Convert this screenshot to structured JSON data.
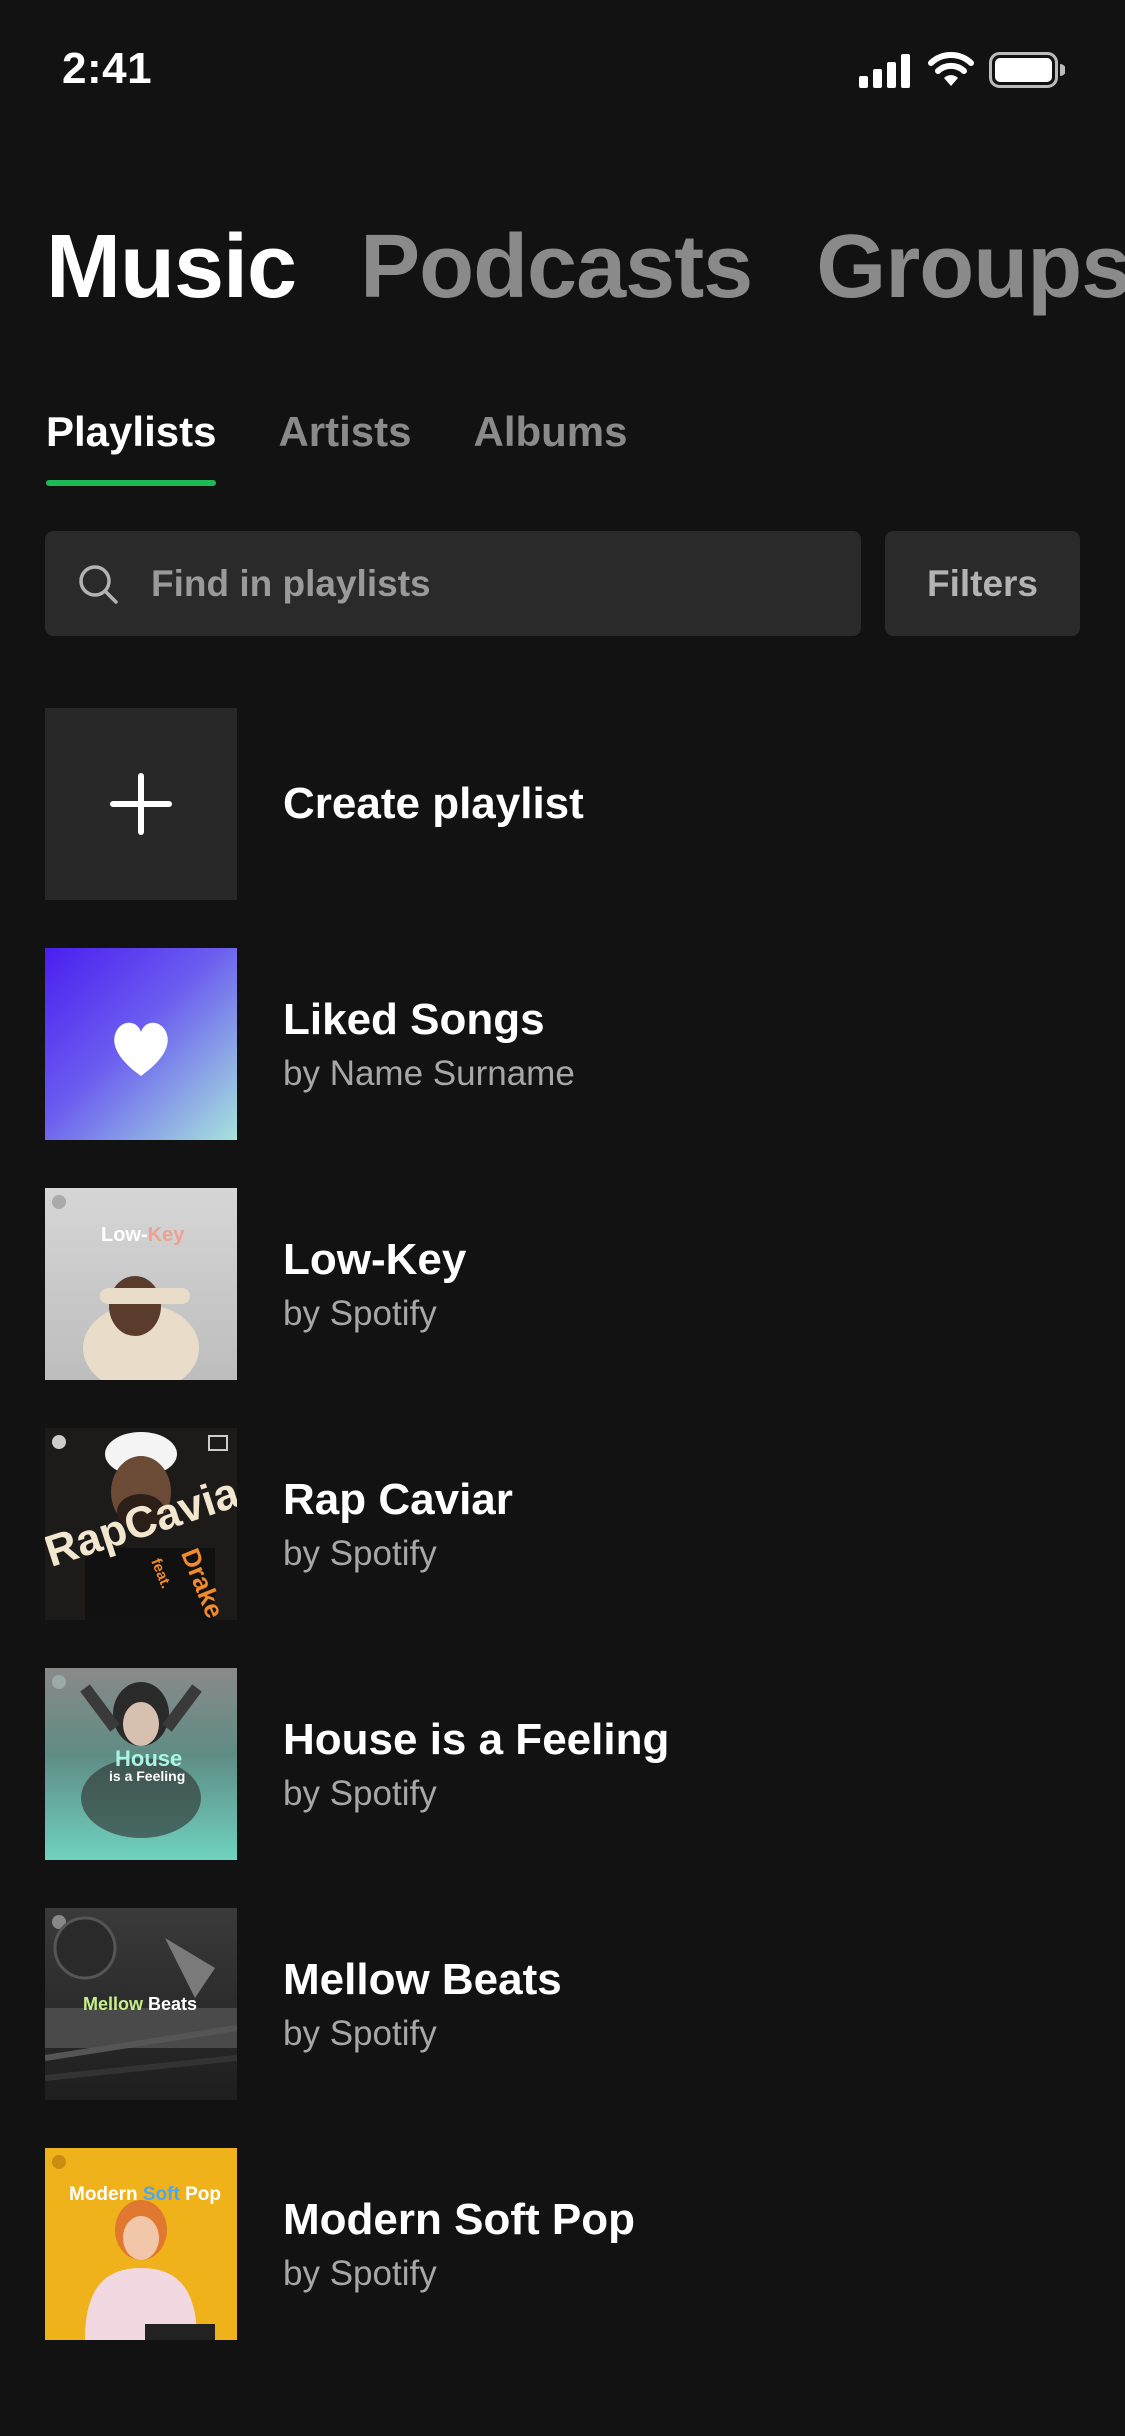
{
  "status_bar": {
    "time": "2:41",
    "icons": [
      "cellular-signal-icon",
      "wifi-icon",
      "battery-icon"
    ]
  },
  "main_tabs": [
    {
      "label": "Music",
      "active": true
    },
    {
      "label": "Podcasts",
      "active": false
    },
    {
      "label": "Groups",
      "active": false
    }
  ],
  "sub_tabs": [
    {
      "label": "Playlists",
      "active": true
    },
    {
      "label": "Artists",
      "active": false
    },
    {
      "label": "Albums",
      "active": false
    }
  ],
  "search": {
    "placeholder": "Find in playlists",
    "value": "",
    "filters_label": "Filters"
  },
  "create_playlist": {
    "label": "Create playlist"
  },
  "playlists": [
    {
      "title": "Liked Songs",
      "subtitle": "by Name Surname",
      "cover": "liked-songs-cover"
    },
    {
      "title": "Low-Key",
      "subtitle": "by Spotify",
      "cover": "low-key-cover",
      "cover_text": [
        "Low-",
        "Key"
      ]
    },
    {
      "title": "Rap Caviar",
      "subtitle": "by Spotify",
      "cover": "rap-caviar-cover",
      "cover_text": [
        "RapCaviar",
        "feat.",
        "Drake"
      ]
    },
    {
      "title": "House is a Feeling",
      "subtitle": "by Spotify",
      "cover": "house-is-a-feeling-cover",
      "cover_text": [
        "House",
        "is a Feeling"
      ]
    },
    {
      "title": "Mellow Beats",
      "subtitle": "by Spotify",
      "cover": "mellow-beats-cover",
      "cover_text": [
        "Mellow",
        "Beats"
      ]
    },
    {
      "title": "Modern Soft Pop",
      "subtitle": "by Spotify",
      "cover": "modern-soft-pop-cover",
      "cover_text": [
        "Modern",
        "Soft",
        "Pop"
      ]
    }
  ],
  "colors": {
    "background": "#121212",
    "accent": "#1db954",
    "surface": "#2a2a2a",
    "text_primary": "#ffffff",
    "text_secondary": "#a7a7a7"
  }
}
